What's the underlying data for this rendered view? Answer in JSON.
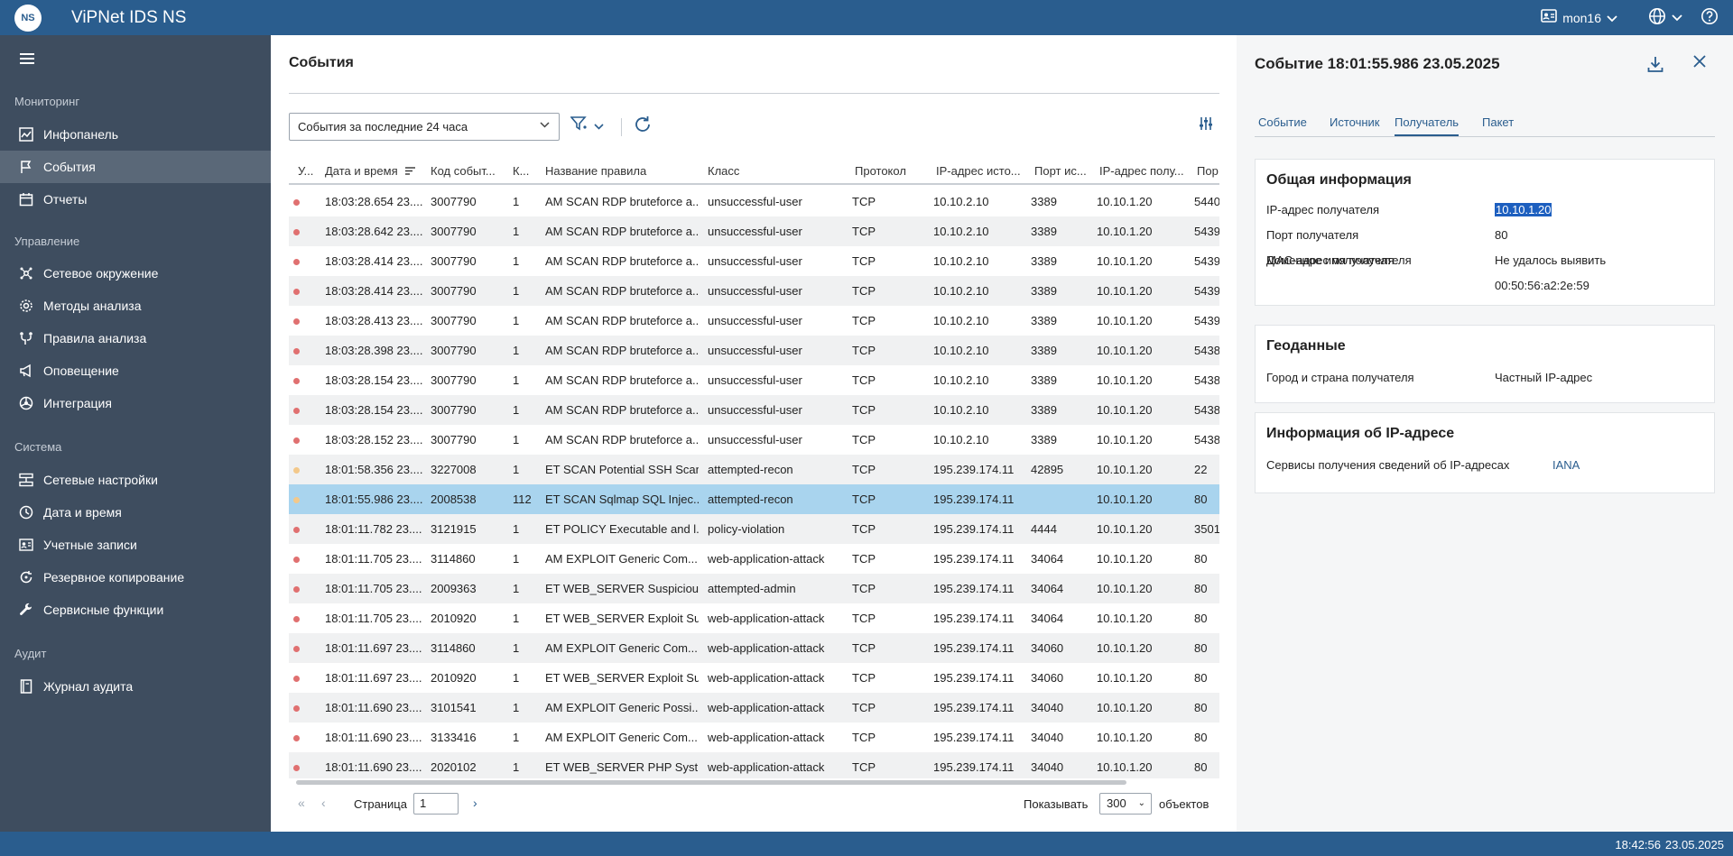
{
  "app": {
    "title_prefix": "ViPNet",
    "title_main": "IDS NS",
    "logo_text": "NS"
  },
  "topbar": {
    "user": "mon16"
  },
  "sidebar": {
    "sections": [
      {
        "title": "Мониторинг",
        "items": [
          "Инфопанель",
          "События",
          "Отчеты"
        ]
      },
      {
        "title": "Управление",
        "items": [
          "Сетевое окружение",
          "Методы анализа",
          "Правила анализа",
          "Оповещение",
          "Интеграция"
        ]
      },
      {
        "title": "Система",
        "items": [
          "Сетевые настройки",
          "Дата и время",
          "Учетные записи",
          "Резервное копирование",
          "Сервисные функции"
        ]
      },
      {
        "title": "Аудит",
        "items": [
          "Журнал аудита"
        ]
      }
    ],
    "active": "События"
  },
  "main": {
    "title": "События",
    "period": "События за последние 24 часа",
    "columns": [
      "У...",
      "Дата и время",
      "Код событ...",
      "К...",
      "Название правила",
      "Класс",
      "Протокол",
      "IP-адрес исто...",
      "Порт ис...",
      "IP-адрес полу...",
      "Пор"
    ],
    "rows": [
      {
        "sev": "high",
        "time": "18:03:28.654 23....",
        "code": "3007790",
        "k": "1",
        "rule": "AM SCAN RDP bruteforce a...",
        "cls": "unsuccessful-user",
        "proto": "TCP",
        "src": "10.10.2.10",
        "sport": "3389",
        "dst": "10.10.1.20",
        "dport": "5440"
      },
      {
        "sev": "high",
        "time": "18:03:28.642 23....",
        "code": "3007790",
        "k": "1",
        "rule": "AM SCAN RDP bruteforce a...",
        "cls": "unsuccessful-user",
        "proto": "TCP",
        "src": "10.10.2.10",
        "sport": "3389",
        "dst": "10.10.1.20",
        "dport": "5439"
      },
      {
        "sev": "high",
        "time": "18:03:28.414 23....",
        "code": "3007790",
        "k": "1",
        "rule": "AM SCAN RDP bruteforce a...",
        "cls": "unsuccessful-user",
        "proto": "TCP",
        "src": "10.10.2.10",
        "sport": "3389",
        "dst": "10.10.1.20",
        "dport": "5439"
      },
      {
        "sev": "high",
        "time": "18:03:28.414 23....",
        "code": "3007790",
        "k": "1",
        "rule": "AM SCAN RDP bruteforce a...",
        "cls": "unsuccessful-user",
        "proto": "TCP",
        "src": "10.10.2.10",
        "sport": "3389",
        "dst": "10.10.1.20",
        "dport": "5439"
      },
      {
        "sev": "high",
        "time": "18:03:28.413 23....",
        "code": "3007790",
        "k": "1",
        "rule": "AM SCAN RDP bruteforce a...",
        "cls": "unsuccessful-user",
        "proto": "TCP",
        "src": "10.10.2.10",
        "sport": "3389",
        "dst": "10.10.1.20",
        "dport": "5439"
      },
      {
        "sev": "high",
        "time": "18:03:28.398 23....",
        "code": "3007790",
        "k": "1",
        "rule": "AM SCAN RDP bruteforce a...",
        "cls": "unsuccessful-user",
        "proto": "TCP",
        "src": "10.10.2.10",
        "sport": "3389",
        "dst": "10.10.1.20",
        "dport": "5438"
      },
      {
        "sev": "high",
        "time": "18:03:28.154 23....",
        "code": "3007790",
        "k": "1",
        "rule": "AM SCAN RDP bruteforce a...",
        "cls": "unsuccessful-user",
        "proto": "TCP",
        "src": "10.10.2.10",
        "sport": "3389",
        "dst": "10.10.1.20",
        "dport": "5438"
      },
      {
        "sev": "high",
        "time": "18:03:28.154 23....",
        "code": "3007790",
        "k": "1",
        "rule": "AM SCAN RDP bruteforce a...",
        "cls": "unsuccessful-user",
        "proto": "TCP",
        "src": "10.10.2.10",
        "sport": "3389",
        "dst": "10.10.1.20",
        "dport": "5438"
      },
      {
        "sev": "high",
        "time": "18:03:28.152 23....",
        "code": "3007790",
        "k": "1",
        "rule": "AM SCAN RDP bruteforce a...",
        "cls": "unsuccessful-user",
        "proto": "TCP",
        "src": "10.10.2.10",
        "sport": "3389",
        "dst": "10.10.1.20",
        "dport": "5438"
      },
      {
        "sev": "medium",
        "time": "18:01:58.356 23....",
        "code": "3227008",
        "k": "1",
        "rule": "ET SCAN Potential SSH Scan",
        "cls": "attempted-recon",
        "proto": "TCP",
        "src": "195.239.174.11",
        "sport": "42895",
        "dst": "10.10.1.20",
        "dport": "22"
      },
      {
        "sev": "medium",
        "time": "18:01:55.986 23....",
        "code": "2008538",
        "k": "112",
        "rule": "ET SCAN Sqlmap SQL Injec...",
        "cls": "attempted-recon",
        "proto": "TCP",
        "src": "195.239.174.11",
        "sport": "",
        "dst": "10.10.1.20",
        "dport": "80",
        "selected": true
      },
      {
        "sev": "high",
        "time": "18:01:11.782 23....",
        "code": "3121915",
        "k": "1",
        "rule": "ET POLICY Executable and l...",
        "cls": "policy-violation",
        "proto": "TCP",
        "src": "195.239.174.11",
        "sport": "4444",
        "dst": "10.10.1.20",
        "dport": "3501"
      },
      {
        "sev": "high",
        "time": "18:01:11.705 23....",
        "code": "3114860",
        "k": "1",
        "rule": "AM EXPLOIT Generic Com...",
        "cls": "web-application-attack",
        "proto": "TCP",
        "src": "195.239.174.11",
        "sport": "34064",
        "dst": "10.10.1.20",
        "dport": "80"
      },
      {
        "sev": "high",
        "time": "18:01:11.705 23....",
        "code": "2009363",
        "k": "1",
        "rule": "ET WEB_SERVER Suspiciou...",
        "cls": "attempted-admin",
        "proto": "TCP",
        "src": "195.239.174.11",
        "sport": "34064",
        "dst": "10.10.1.20",
        "dport": "80"
      },
      {
        "sev": "high",
        "time": "18:01:11.705 23....",
        "code": "2010920",
        "k": "1",
        "rule": "ET WEB_SERVER Exploit Su...",
        "cls": "web-application-attack",
        "proto": "TCP",
        "src": "195.239.174.11",
        "sport": "34064",
        "dst": "10.10.1.20",
        "dport": "80"
      },
      {
        "sev": "high",
        "time": "18:01:11.697 23....",
        "code": "3114860",
        "k": "1",
        "rule": "AM EXPLOIT Generic Com...",
        "cls": "web-application-attack",
        "proto": "TCP",
        "src": "195.239.174.11",
        "sport": "34060",
        "dst": "10.10.1.20",
        "dport": "80"
      },
      {
        "sev": "high",
        "time": "18:01:11.697 23....",
        "code": "2010920",
        "k": "1",
        "rule": "ET WEB_SERVER Exploit Su...",
        "cls": "web-application-attack",
        "proto": "TCP",
        "src": "195.239.174.11",
        "sport": "34060",
        "dst": "10.10.1.20",
        "dport": "80"
      },
      {
        "sev": "high",
        "time": "18:01:11.690 23....",
        "code": "3101541",
        "k": "1",
        "rule": "AM EXPLOIT Generic Possi...",
        "cls": "web-application-attack",
        "proto": "TCP",
        "src": "195.239.174.11",
        "sport": "34040",
        "dst": "10.10.1.20",
        "dport": "80"
      },
      {
        "sev": "high",
        "time": "18:01:11.690 23....",
        "code": "3133416",
        "k": "1",
        "rule": "AM EXPLOIT Generic Com...",
        "cls": "web-application-attack",
        "proto": "TCP",
        "src": "195.239.174.11",
        "sport": "34040",
        "dst": "10.10.1.20",
        "dport": "80"
      },
      {
        "sev": "high",
        "time": "18:01:11.690 23....",
        "code": "2020102",
        "k": "1",
        "rule": "ET WEB_SERVER PHP Syst...",
        "cls": "web-application-attack",
        "proto": "TCP",
        "src": "195.239.174.11",
        "sport": "34040",
        "dst": "10.10.1.20",
        "dport": "80"
      }
    ],
    "pager": {
      "page_label": "Страница",
      "page": "1",
      "show_label": "Показывать",
      "per_page": "300",
      "objects_label": "объектов"
    }
  },
  "panel": {
    "title": "Событие 18:01:55.986 23.05.2025",
    "tabs": [
      "Событие",
      "Источник",
      "Получатель",
      "Пакет"
    ],
    "active_tab": "Получатель",
    "general": {
      "title": "Общая информация",
      "rows": [
        {
          "k": "IP-адрес получателя",
          "v": "10.10.1.20"
        },
        {
          "k": "Порт получателя",
          "v": "80"
        },
        {
          "k": "Доменное имя получателя",
          "v": "Не удалось выявить"
        },
        {
          "k": "MAC-адрес получателя",
          "v": "00:50:56:a2:2e:59"
        }
      ]
    },
    "geo": {
      "title": "Геоданные",
      "k": "Город и страна получателя",
      "v": "Частный IP-адрес"
    },
    "ipinfo": {
      "title": "Информация об IP-адресе",
      "k": "Сервисы получения сведений об IP-адресах",
      "v": "IANA"
    }
  },
  "status": {
    "time": "18:42:56",
    "date": "23.05.2025"
  },
  "colors": {
    "accent": "#2a5d8e",
    "sidebar": "#3e4d5f",
    "selected_row": "#a9d4ee",
    "sev_high": "#e07070",
    "sev_medium": "#f3c88a"
  }
}
